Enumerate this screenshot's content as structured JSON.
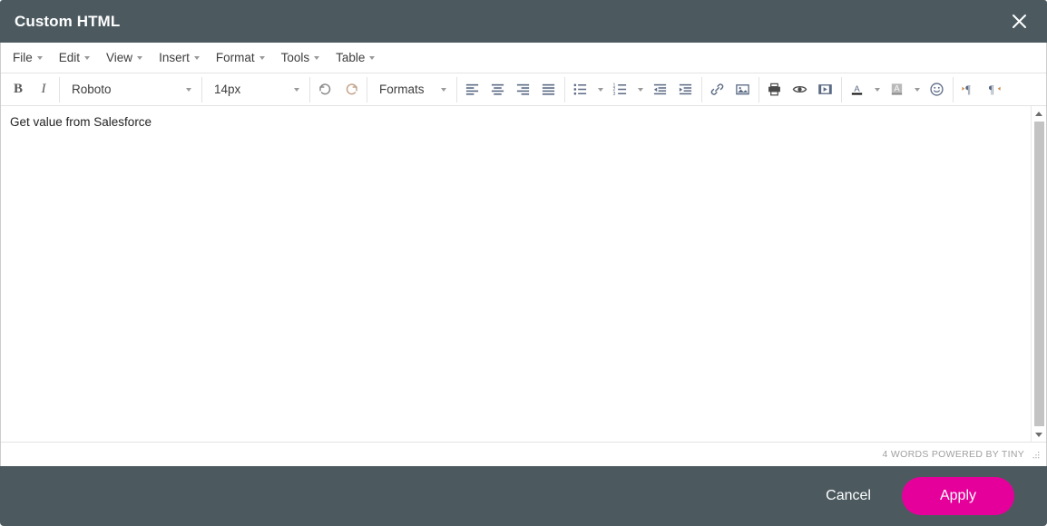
{
  "dialog": {
    "title": "Custom HTML",
    "close_icon": "close-icon"
  },
  "menubar": {
    "items": [
      {
        "label": "File"
      },
      {
        "label": "Edit"
      },
      {
        "label": "View"
      },
      {
        "label": "Insert"
      },
      {
        "label": "Format"
      },
      {
        "label": "Tools"
      },
      {
        "label": "Table"
      }
    ]
  },
  "toolbar": {
    "bold_label": "B",
    "italic_label": "I",
    "font_family": "Roboto",
    "font_size": "14px",
    "formats_label": "Formats",
    "icons": {
      "undo": "undo-icon",
      "redo": "redo-icon",
      "align_left": "align-left-icon",
      "align_center": "align-center-icon",
      "align_right": "align-right-icon",
      "align_justify": "align-justify-icon",
      "bullet_list": "bullet-list-icon",
      "numbered_list": "numbered-list-icon",
      "outdent": "outdent-icon",
      "indent": "indent-icon",
      "link": "link-icon",
      "image": "image-icon",
      "print": "print-icon",
      "preview": "preview-eye-icon",
      "media": "media-icon",
      "text_color": "text-color-icon",
      "background_color": "background-color-icon",
      "emoticon": "emoticon-icon",
      "ltr": "direction-ltr-icon",
      "rtl": "direction-rtl-icon"
    }
  },
  "editor": {
    "content": "Get value from Salesforce"
  },
  "statusbar": {
    "text": "4 words Powered by Tiny",
    "resize_icon": "resize-grip-icon"
  },
  "footer": {
    "cancel_label": "Cancel",
    "apply_label": "Apply"
  },
  "colors": {
    "header_background": "#4c5a60",
    "apply_button": "#e6009b",
    "title_text": "#ffffff",
    "editor_background": "#ffffff",
    "status_text": "#a0a0a0"
  }
}
